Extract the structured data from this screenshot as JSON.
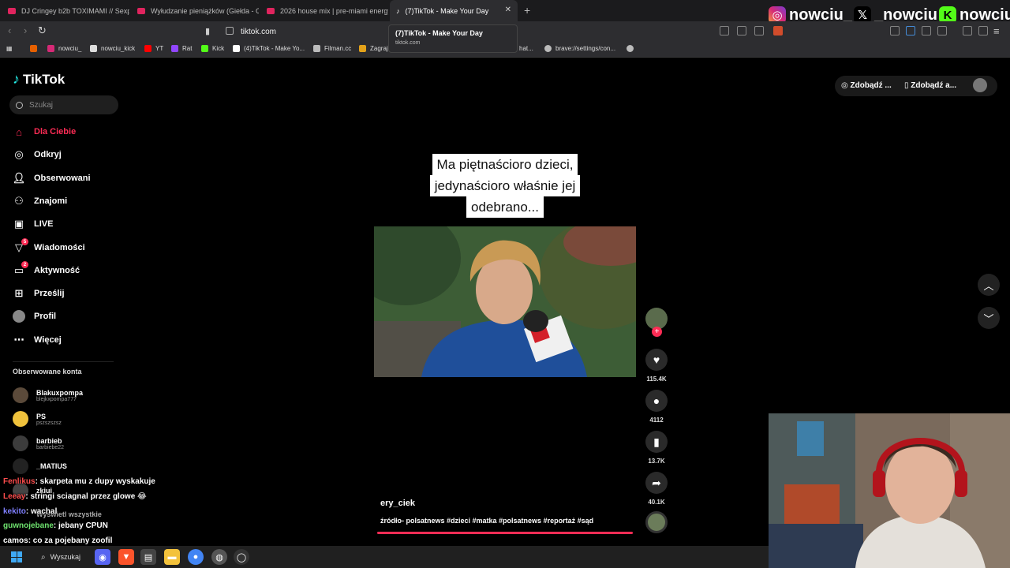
{
  "browser": {
    "tabs": [
      {
        "title": "DJ Cringey b2b TOXIMAMI // Sexpre"
      },
      {
        "title": "Wyłudzanie pieniążków (Giełda - Od"
      },
      {
        "title": "2026 house mix | pre-miami energy"
      },
      {
        "title": "(7)TikTok - Make Your Day",
        "active": true
      }
    ],
    "url": "tiktok.com",
    "tooltip": {
      "title": "(7)TikTok - Make Your Day",
      "domain": "tiktok.com"
    },
    "bookmarks": [
      {
        "label": "nowciu_",
        "color": "#d62976"
      },
      {
        "label": "nowciu_kick",
        "color": "#dddddd"
      },
      {
        "label": "YT",
        "color": "#ff0000"
      },
      {
        "label": "Rat",
        "color": "#9146ff"
      },
      {
        "label": "Kick",
        "color": "#53fc18"
      },
      {
        "label": "(4)TikTok - Make Yo...",
        "color": "#ffffff"
      },
      {
        "label": "Filman.cc",
        "color": "#bbbbbb"
      },
      {
        "label": "Zagraj",
        "color": "#e3a21a"
      },
      {
        "label": "hat...",
        "color": "#888888"
      },
      {
        "label": "brave://settings/con...",
        "color": "#bbbbbb"
      }
    ]
  },
  "stream_overlay": {
    "instagram": "nowciu_",
    "x": "_nowciu",
    "kick": "nowciu"
  },
  "tiktok": {
    "logo": "TikTok",
    "search_placeholder": "Szukaj",
    "nav": [
      {
        "label": "Dla Ciebie",
        "icon": "home-icon",
        "active": true
      },
      {
        "label": "Odkryj",
        "icon": "compass-icon"
      },
      {
        "label": "Obserwowani",
        "icon": "person-icon"
      },
      {
        "label": "Znajomi",
        "icon": "friends-icon"
      },
      {
        "label": "LIVE",
        "icon": "live-icon"
      },
      {
        "label": "Wiadomości",
        "icon": "messages-icon",
        "badge": "5"
      },
      {
        "label": "Aktywność",
        "icon": "activity-icon",
        "badge": "2"
      },
      {
        "label": "Prześlij",
        "icon": "upload-icon"
      },
      {
        "label": "Profil",
        "icon": "avatar-icon"
      },
      {
        "label": "Więcej",
        "icon": "more-icon"
      }
    ],
    "followed_title": "Obserwowane konta",
    "followed": [
      {
        "name": "Blakuxpompa",
        "username": "blejkxpompa777"
      },
      {
        "name": "PS",
        "username": "pszszszsz"
      },
      {
        "name": "barbieb",
        "username": "barbiebe22"
      },
      {
        "name": "_MATIUS",
        "username": ""
      },
      {
        "name": "zkiui",
        "username": ""
      },
      {
        "name": "Wyświetl wszystkie",
        "username": ""
      }
    ],
    "top_actions": [
      "Zdobądź ...",
      "Zdobądź a..."
    ],
    "video": {
      "caption_lines": [
        "Ma piętnaścioro dzieci,",
        "jedynaścioro właśnie jej",
        "odebrano..."
      ],
      "author": "ery_ciek",
      "description": "źródło- polsatnews #dzieci #matka #polsatnews #reportaż #sąd",
      "likes": "115.4K",
      "comments": "4112",
      "saves": "13.7K",
      "shares": "40.1K"
    }
  },
  "chat": [
    {
      "user": "Fenlikus",
      "color": "#ff4d4d",
      "text": ": skarpeta mu z dupy wyskakuje"
    },
    {
      "user": "Leeay",
      "color": "#ff4d4d",
      "text": ": stringi sciagnal przez glowe 😂"
    },
    {
      "user": "kekito",
      "color": "#7f7fff",
      "text": ": wachal"
    },
    {
      "user": "guwnojebane",
      "color": "#6fe36f",
      "text": ": jebany CPUN"
    },
    {
      "user": "camos",
      "color": "#ffffff",
      "text": ": co za pojebany zoofil"
    }
  ],
  "taskbar": {
    "search": "Wyszukaj"
  }
}
